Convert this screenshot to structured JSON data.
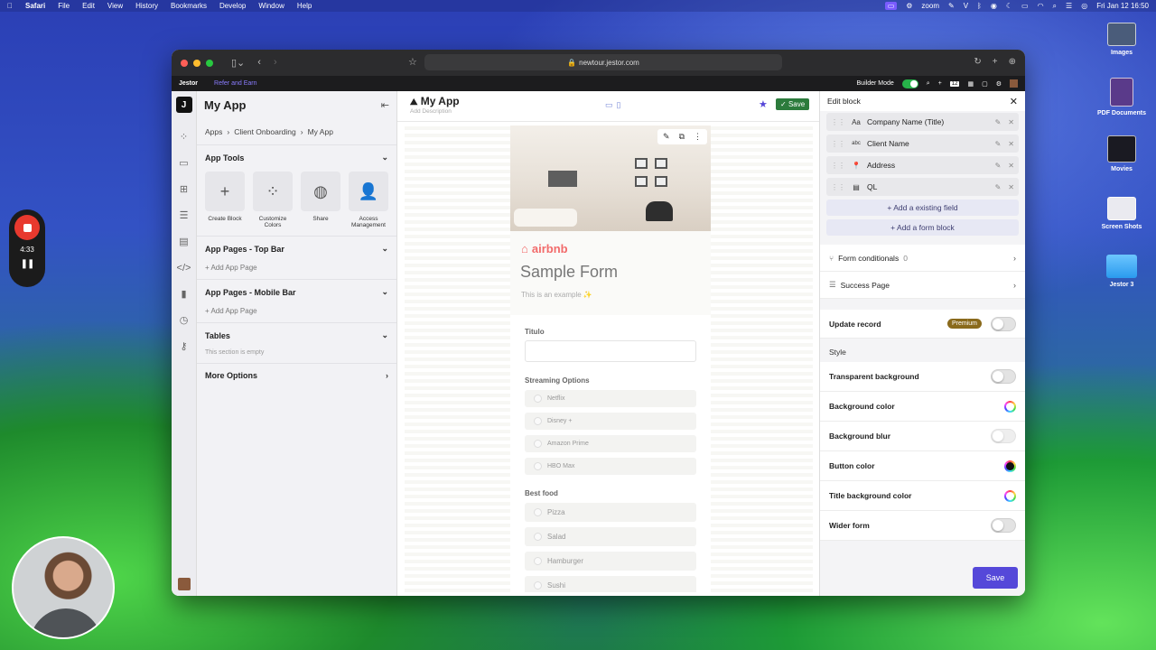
{
  "menubar": {
    "items": [
      "Safari",
      "File",
      "Edit",
      "View",
      "History",
      "Bookmarks",
      "Develop",
      "Window",
      "Help"
    ],
    "zoom": "zoom",
    "clock": "Fri Jan 12  16:50"
  },
  "desktop": {
    "icons": [
      {
        "label": "Images"
      },
      {
        "label": "PDF Documents"
      },
      {
        "label": "Movies"
      },
      {
        "label": "Screen Shots"
      },
      {
        "label": "Jestor 3"
      }
    ]
  },
  "recorder": {
    "time": "4:33"
  },
  "browser": {
    "url": "newtour.jestor.com"
  },
  "jestorbar": {
    "brand": "Jestor",
    "earn": "Refer and Earn",
    "builder_mode": "Builder Mode",
    "calendar_day": "12"
  },
  "sidebar": {
    "title": "My App",
    "breadcrumb": [
      "Apps",
      "Client Onboarding",
      "My App"
    ],
    "app_tools_title": "App Tools",
    "tools": [
      {
        "label": "Create Block",
        "icon": "plus-icon"
      },
      {
        "label": "Customize Colors",
        "icon": "palette-icon"
      },
      {
        "label": "Share",
        "icon": "globe-icon"
      },
      {
        "label": "Access Management",
        "icon": "users-icon"
      }
    ],
    "top_bar_title": "App Pages - Top Bar",
    "mobile_bar_title": "App Pages - Mobile Bar",
    "add_page": "+ Add App Page",
    "tables_title": "Tables",
    "tables_empty": "This section is empty",
    "more_options": "More Options"
  },
  "main": {
    "title": "My App",
    "description": "Add Description",
    "save_label": "Save"
  },
  "form": {
    "brand": "airbnb",
    "title": "Sample Form",
    "subtitle": "This is an example ✨",
    "fields": {
      "titulo": "Titulo",
      "streaming": "Streaming Options",
      "streaming_options": [
        "Netflix",
        "Disney +",
        "Amazon Prime",
        "HBO Max"
      ],
      "food": "Best food",
      "food_options": [
        "Pizza",
        "Salad",
        "Hamburger",
        "Sushi"
      ]
    }
  },
  "panel": {
    "title": "Edit block",
    "fields": [
      {
        "label": "Company Name (Title)",
        "icon": "Aa"
      },
      {
        "label": "Client Name",
        "icon": "abc"
      },
      {
        "label": "Address",
        "icon": "📍"
      },
      {
        "label": "QL",
        "icon": "▤"
      }
    ],
    "add_existing": "+ Add a existing field",
    "add_block": "+ Add a form block",
    "conditionals": "Form conditionals",
    "conditionals_count": "0",
    "success_page": "Success Page",
    "update_record": "Update record",
    "premium": "Premium",
    "style": "Style",
    "transparent_bg": "Transparent background",
    "bg_color": "Background color",
    "bg_blur": "Background blur",
    "button_color": "Button color",
    "title_bg_color": "Title background color",
    "wider_form": "Wider form",
    "save": "Save"
  }
}
